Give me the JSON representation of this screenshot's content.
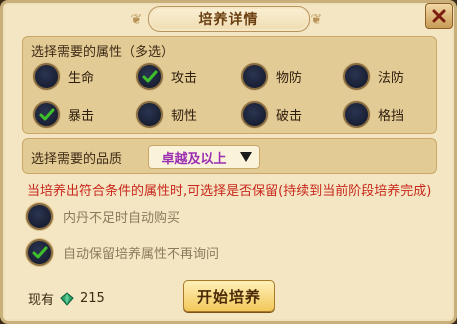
{
  "dialog": {
    "title": "培养详情",
    "close_icon": "close-icon"
  },
  "attributes": {
    "section_label": "选择需要的属性（多选）",
    "items": [
      {
        "label": "生命",
        "checked": false
      },
      {
        "label": "攻击",
        "checked": true
      },
      {
        "label": "物防",
        "checked": false
      },
      {
        "label": "法防",
        "checked": false
      },
      {
        "label": "暴击",
        "checked": true
      },
      {
        "label": "韧性",
        "checked": false
      },
      {
        "label": "破击",
        "checked": false
      },
      {
        "label": "格挡",
        "checked": false
      }
    ]
  },
  "quality": {
    "label": "选择需要的品质",
    "selected": "卓越及以上"
  },
  "notice": "当培养出符合条件的属性时,可选择是否保留(持续到当前阶段培养完成)",
  "options": [
    {
      "label": "内丹不足时自动购买",
      "checked": false
    },
    {
      "label": "自动保留培养属性不再询问",
      "checked": true
    }
  ],
  "currency": {
    "label": "现有",
    "icon": "gem-icon",
    "amount": "215"
  },
  "start_button": "开始培养",
  "colors": {
    "accent_red": "#c8271d",
    "quality_purple": "#9b2fb1",
    "check_green": "#3fbf2a"
  }
}
